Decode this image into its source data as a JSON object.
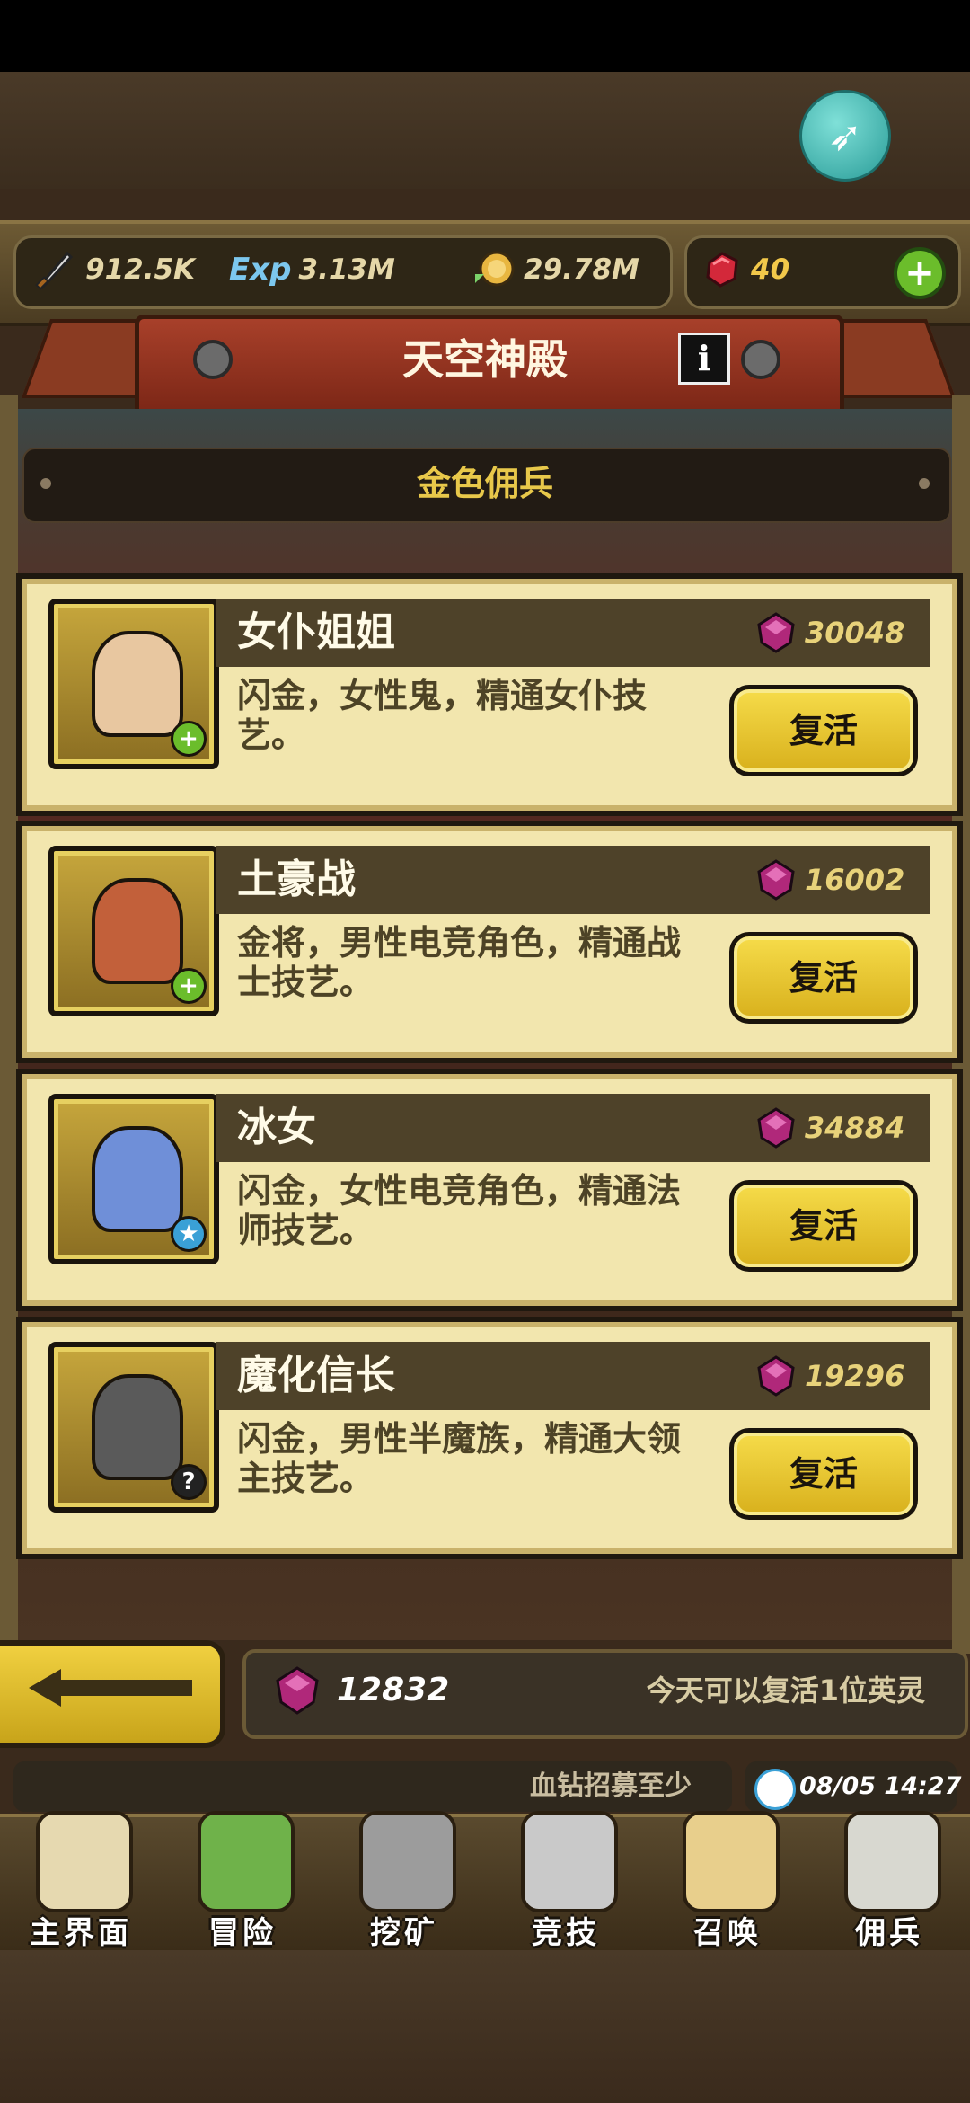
{
  "resources": {
    "attack": "912.5K",
    "exp": "3.13M",
    "gold": "29.78M",
    "ruby": "40"
  },
  "banner": {
    "title": "天空神殿"
  },
  "section": {
    "title": "金色佣兵"
  },
  "mercenaries": [
    {
      "name": "女仆姐姐",
      "price": "30048",
      "desc": "闪金，女性鬼，精通女仆技艺。",
      "button": "复活",
      "badge": "+",
      "badge_color": "#6bbd2b"
    },
    {
      "name": "土豪战",
      "price": "16002",
      "desc": "金将，男性电竞角色，精通战士技艺。",
      "button": "复活",
      "badge": "+",
      "badge_color": "#6bbd2b"
    },
    {
      "name": "冰女",
      "price": "34884",
      "desc": "闪金，女性电竞角色，精通法师技艺。",
      "button": "复活",
      "badge": "★",
      "badge_color": "#3aa0d6"
    },
    {
      "name": "魔化信长",
      "price": "19296",
      "desc": "闪金，男性半魔族，精通大领主技艺。",
      "button": "复活",
      "badge": "?",
      "badge_color": "#222222"
    }
  ],
  "footer": {
    "gem_count": "12832",
    "revive_info": "今天可以复活1位英灵",
    "ticker": "血钻招募至少",
    "time": "08/05 14:27"
  },
  "nav": [
    {
      "label": "主界面",
      "icon": "map-scroll-icon"
    },
    {
      "label": "冒险",
      "icon": "island-icon"
    },
    {
      "label": "挖矿",
      "icon": "pickaxe-icon"
    },
    {
      "label": "竞技",
      "icon": "crossed-swords-icon"
    },
    {
      "label": "召唤",
      "icon": "summon-scroll-icon"
    },
    {
      "label": "佣兵",
      "icon": "tent-icon"
    }
  ],
  "colors": {
    "accent_gold": "#e8c84a",
    "gem_purple": "#b0287a",
    "card_bg": "#f2e6ae"
  }
}
